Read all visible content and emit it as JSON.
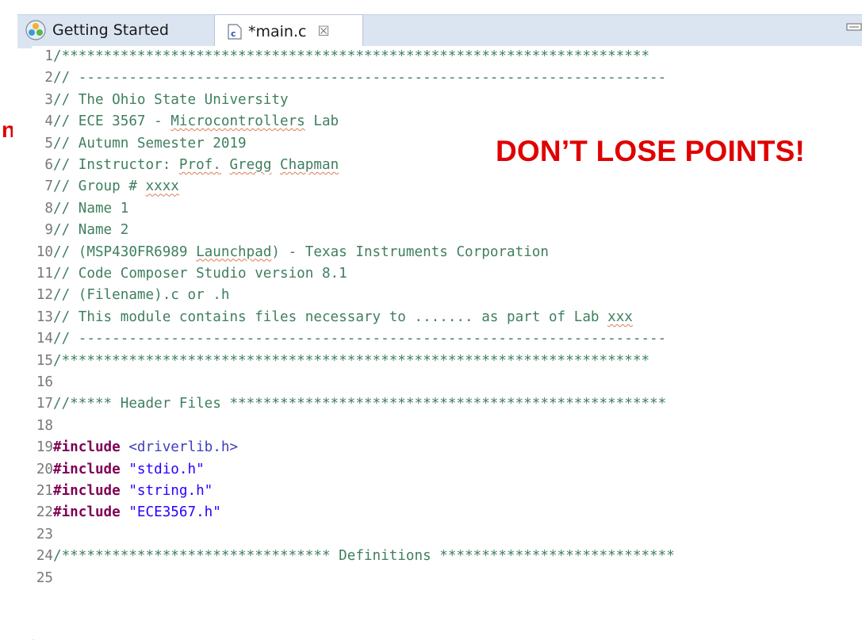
{
  "tabs": {
    "getting_started": "Getting Started",
    "main_c": "*main.c",
    "close_glyph": "☒"
  },
  "banner": "DON’T LOSE POINTS!",
  "edge_text": "n",
  "lines": [
    {
      "n": "1",
      "parts": [
        {
          "t": "/**********************************************************************",
          "c": "comment"
        }
      ]
    },
    {
      "n": "2",
      "parts": [
        {
          "t": "// ----------------------------------------------------------------------",
          "c": "comment"
        }
      ]
    },
    {
      "n": "3",
      "parts": [
        {
          "t": "// The Ohio State University",
          "c": "comment"
        }
      ]
    },
    {
      "n": "4",
      "parts": [
        {
          "t": "// ECE 3567 - ",
          "c": "comment"
        },
        {
          "t": "Microcontrollers",
          "c": "comment",
          "s": true
        },
        {
          "t": " Lab",
          "c": "comment"
        }
      ]
    },
    {
      "n": "5",
      "parts": [
        {
          "t": "// Autumn Semester 2019",
          "c": "comment"
        }
      ]
    },
    {
      "n": "6",
      "parts": [
        {
          "t": "// Instructor: ",
          "c": "comment"
        },
        {
          "t": "Prof.",
          "c": "comment",
          "s": true
        },
        {
          "t": " ",
          "c": "comment"
        },
        {
          "t": "Gregg",
          "c": "comment",
          "s": true
        },
        {
          "t": " ",
          "c": "comment"
        },
        {
          "t": "Chapman",
          "c": "comment",
          "s": true
        }
      ]
    },
    {
      "n": "7",
      "parts": [
        {
          "t": "// Group # ",
          "c": "comment"
        },
        {
          "t": "xxxx",
          "c": "comment",
          "s": true
        }
      ]
    },
    {
      "n": "8",
      "parts": [
        {
          "t": "// Name 1",
          "c": "comment"
        }
      ]
    },
    {
      "n": "9",
      "parts": [
        {
          "t": "// Name 2",
          "c": "comment"
        }
      ]
    },
    {
      "n": "10",
      "parts": [
        {
          "t": "// (MSP430FR6989 ",
          "c": "comment"
        },
        {
          "t": "Launchpad",
          "c": "comment",
          "s": true
        },
        {
          "t": ") - Texas Instruments Corporation",
          "c": "comment"
        }
      ]
    },
    {
      "n": "11",
      "parts": [
        {
          "t": "// Code Composer Studio version 8.1",
          "c": "comment"
        }
      ]
    },
    {
      "n": "12",
      "parts": [
        {
          "t": "// (Filename).c or .h",
          "c": "comment"
        }
      ]
    },
    {
      "n": "13",
      "parts": [
        {
          "t": "// This module contains files necessary to ....... as part of Lab ",
          "c": "comment"
        },
        {
          "t": "xxx",
          "c": "comment",
          "s": true
        }
      ]
    },
    {
      "n": "14",
      "parts": [
        {
          "t": "// ----------------------------------------------------------------------",
          "c": "comment"
        }
      ]
    },
    {
      "n": "15",
      "parts": [
        {
          "t": "/**********************************************************************",
          "c": "comment"
        }
      ]
    },
    {
      "n": "16",
      "parts": []
    },
    {
      "n": "17",
      "parts": [
        {
          "t": "//***** Header Files ****************************************************",
          "c": "comment"
        }
      ]
    },
    {
      "n": "18",
      "parts": []
    },
    {
      "n": "19",
      "parts": [
        {
          "t": "#include",
          "c": "kw"
        },
        {
          "t": " ",
          "c": "plain"
        },
        {
          "t": "<driverlib.h>",
          "c": "sys"
        }
      ]
    },
    {
      "n": "20",
      "parts": [
        {
          "t": "#include",
          "c": "kw"
        },
        {
          "t": " ",
          "c": "plain"
        },
        {
          "t": "\"stdio.h\"",
          "c": "str"
        }
      ]
    },
    {
      "n": "21",
      "parts": [
        {
          "t": "#include",
          "c": "kw"
        },
        {
          "t": " ",
          "c": "plain"
        },
        {
          "t": "\"string.h\"",
          "c": "str"
        }
      ]
    },
    {
      "n": "22",
      "parts": [
        {
          "t": "#include",
          "c": "kw"
        },
        {
          "t": " ",
          "c": "plain"
        },
        {
          "t": "\"ECE3567.h\"",
          "c": "str"
        }
      ]
    },
    {
      "n": "23",
      "parts": []
    },
    {
      "n": "24",
      "parts": [
        {
          "t": "/******************************** Definitions ****************************",
          "c": "comment"
        }
      ]
    },
    {
      "n": "25",
      "parts": []
    }
  ]
}
